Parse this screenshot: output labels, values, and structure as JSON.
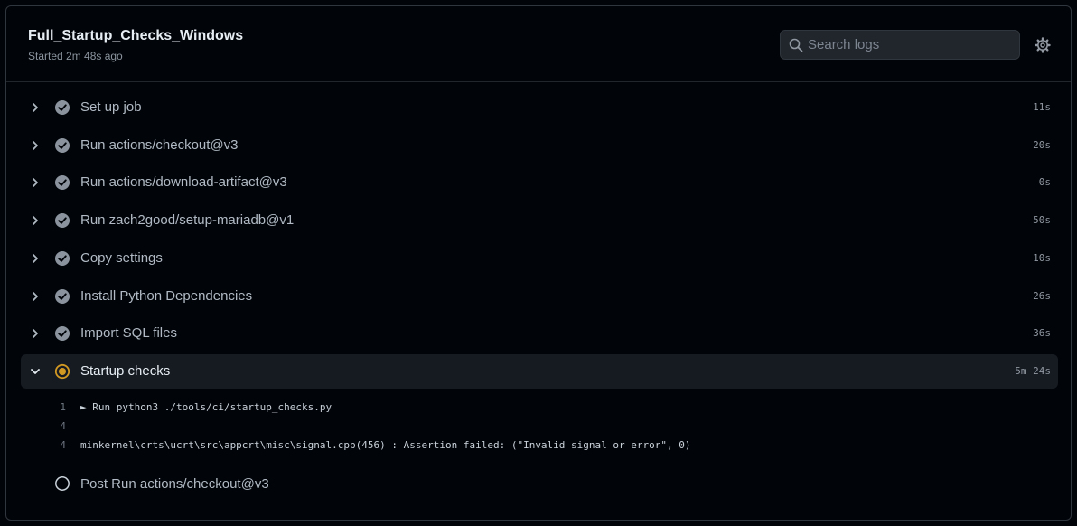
{
  "job": {
    "title": "Full_Startup_Checks_Windows",
    "started": "Started 2m 48s ago"
  },
  "search": {
    "placeholder": "Search logs",
    "value": ""
  },
  "icons": {
    "search": "search-icon",
    "settings": "gear-icon",
    "expand": "chevron-right-icon",
    "collapse": "chevron-down-icon",
    "success": "check-circle-icon",
    "running": "in-progress-icon",
    "pending": "empty-circle-icon"
  },
  "colors": {
    "success": "#8b949e",
    "running": "#d29922",
    "background": "#010409"
  },
  "steps": [
    {
      "name": "Set up job",
      "duration": "11s",
      "status": "success"
    },
    {
      "name": "Run actions/checkout@v3",
      "duration": "20s",
      "status": "success"
    },
    {
      "name": "Run actions/download-artifact@v3",
      "duration": "0s",
      "status": "success"
    },
    {
      "name": "Run zach2good/setup-mariadb@v1",
      "duration": "50s",
      "status": "success"
    },
    {
      "name": "Copy settings",
      "duration": "10s",
      "status": "success"
    },
    {
      "name": "Install Python Dependencies",
      "duration": "26s",
      "status": "success"
    },
    {
      "name": "Import SQL files",
      "duration": "36s",
      "status": "success"
    },
    {
      "name": "Startup checks",
      "duration": "5m 24s",
      "status": "running"
    }
  ],
  "log": [
    {
      "line": "1",
      "text": "► Run python3 ./tools/ci/startup_checks.py"
    },
    {
      "line": "4",
      "text": ""
    },
    {
      "line": "4",
      "text": "minkernel\\crts\\ucrt\\src\\appcrt\\misc\\signal.cpp(456) : Assertion failed: (\"Invalid signal or error\", 0)"
    }
  ],
  "post_step": {
    "name": "Post Run actions/checkout@v3",
    "status": "pending"
  }
}
